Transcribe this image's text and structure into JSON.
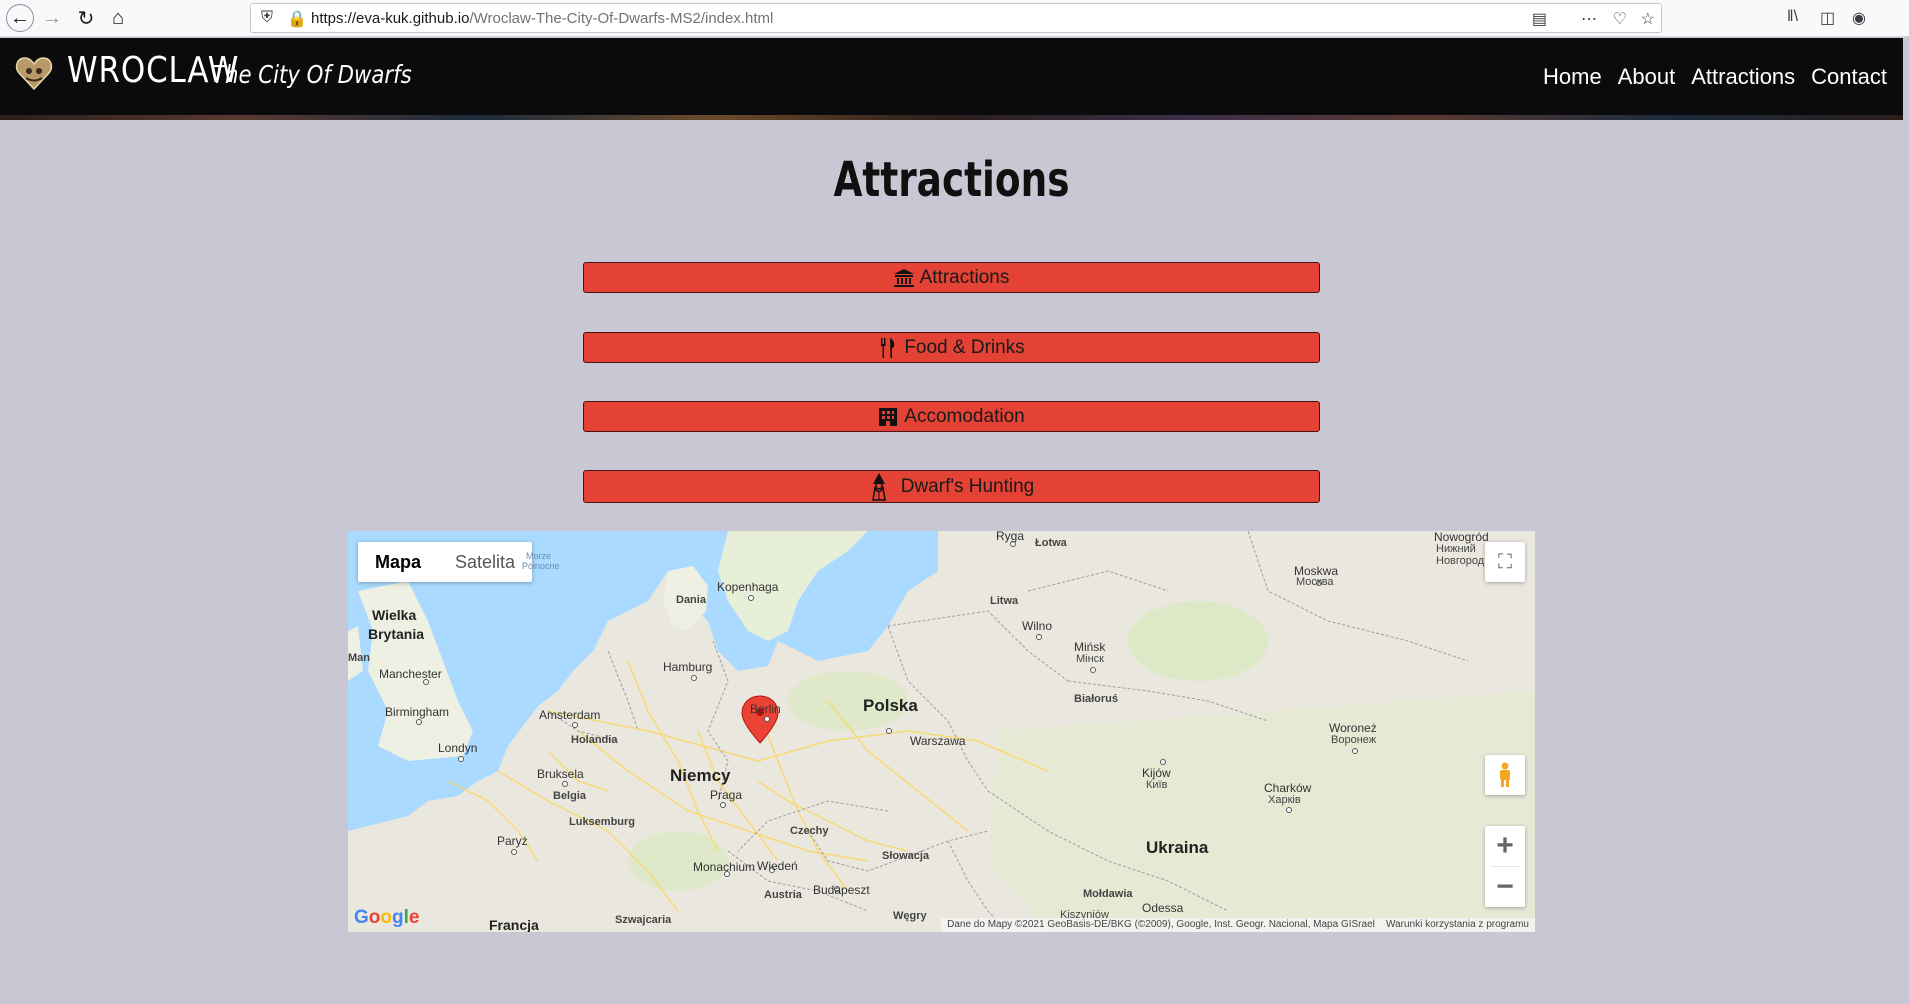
{
  "browser": {
    "url_host": "https://eva-kuk.github.io",
    "url_path": "/Wroclaw-The-City-Of-Dwarfs-MS2/index.html",
    "icons": [
      "back-icon",
      "forward-icon",
      "reload-icon",
      "home-icon",
      "shield-icon",
      "lock-icon",
      "reader-icon",
      "more-icon",
      "pocket-icon",
      "bookmark-star-icon",
      "library-icon",
      "sidebar-icon",
      "account-icon"
    ]
  },
  "header": {
    "brand_main": "WROCLAW",
    "brand_sub": "The City Of Dwarfs",
    "menu": [
      "Home",
      "About",
      "Attractions",
      "Contact"
    ]
  },
  "main": {
    "title": "Attractions",
    "buttons": [
      {
        "label": "Attractions",
        "icon": "landmark-icon"
      },
      {
        "label": "Food & Drinks",
        "icon": "utensils-icon"
      },
      {
        "label": "Accomodation",
        "icon": "hotel-icon"
      },
      {
        "label": "Dwarf's Hunting",
        "icon": "dwarf-icon"
      }
    ],
    "button_color": "#e34234"
  },
  "map": {
    "type_buttons": [
      "Mapa",
      "Satelita"
    ],
    "google": "Google",
    "attribution": "Dane do Mapy ©2021 GeoBasis-DE/BKG (©2009), Google, Inst. Geogr. Nacional, Mapa GISrael",
    "terms": "Warunki korzystania z programu",
    "labels": {
      "polska": "Polska",
      "niemcy": "Niemcy",
      "ukraina": "Ukraina",
      "czechy": "Czechy",
      "slowacja": "Słowacja",
      "wegry": "Węgry",
      "austria": "Austria",
      "holandia": "Holandia",
      "belgia": "Belgia",
      "luksemburg": "Luksemburg",
      "francja": "Francja",
      "dania": "Dania",
      "litwa": "Litwa",
      "lotwa": "Łotwa",
      "moldawia": "Mołdawia",
      "szwajcaria": "Szwajcaria",
      "wielka": "Wielka",
      "brytania": "Brytania",
      "man": "Man",
      "warszawa": "Warszawa",
      "berlin": "Berlin",
      "hamburg": "Hamburg",
      "kopenhaga": "Kopenhaga",
      "amsterdam": "Amsterdam",
      "bruksela": "Bruksela",
      "paryz": "Paryż",
      "londyn": "Londyn",
      "birmingham": "Birmingham",
      "manchester": "Manchester",
      "praga": "Praga",
      "wieden": "Wiedeń",
      "budapeszt": "Budapeszt",
      "monachium": "Monachium",
      "wilno": "Wilno",
      "minsk": "Mińsk",
      "minsk_ru": "Мінск",
      "bialorus": "Białoruś",
      "ryga": "Ryga",
      "kijow": "Kijów",
      "kijow_ru": "Київ",
      "charkow": "Charków",
      "charkow_ru": "Харків",
      "woronez": "Woroneż",
      "woronez_ru": "Воронеж",
      "moskwa": "Moskwa",
      "moskwa_ru": "Москва",
      "nowogrod": "Nowogród",
      "nowogrod_ru1": "Нижний",
      "nowogrod_ru2": "Новгород",
      "odessa": "Odessa",
      "kiszyniow": "Kiszyniów",
      "morze": "Morze",
      "polnocne": "Północne"
    }
  }
}
